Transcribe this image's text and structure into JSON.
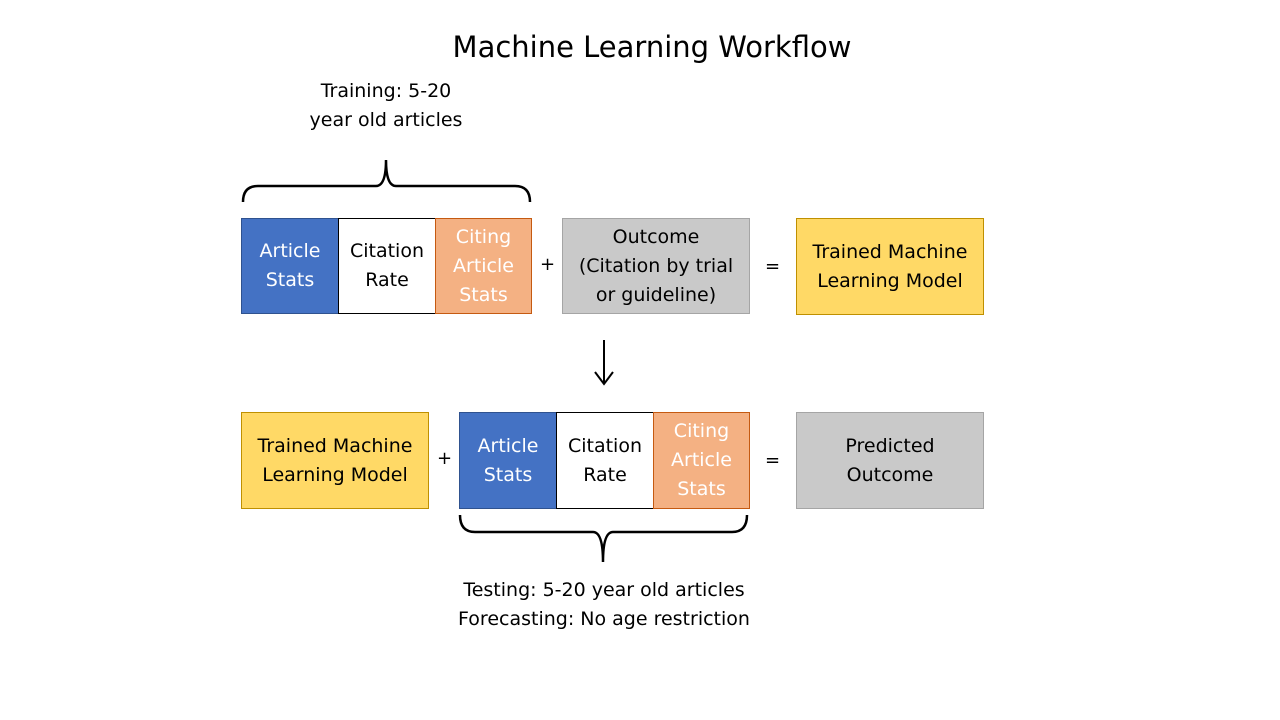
{
  "title": "Machine Learning Workflow",
  "training_note": "Training: 5-20\nyear old articles",
  "testing_note": "Testing: 5-20 year old articles\nForecasting: No age restriction",
  "colors": {
    "article_stats": "#4472C4",
    "citation_rate": "#FFFFFF",
    "citing_article_stats": "#F4B183",
    "outcome": "#C9C9C9",
    "model": "#FFD966"
  },
  "row1": {
    "article_stats": "Article\nStats",
    "citation_rate": "Citation\nRate",
    "citing_article_stats": "Citing\nArticle\nStats",
    "plus": "+",
    "outcome": "Outcome\n(Citation by trial\nor guideline)",
    "equals": "=",
    "model": "Trained Machine\nLearning Model"
  },
  "row2": {
    "model": "Trained Machine\nLearning Model",
    "plus": "+",
    "article_stats": "Article\nStats",
    "citation_rate": "Citation\nRate",
    "citing_article_stats": "Citing\nArticle\nStats",
    "equals": "=",
    "predicted": "Predicted\nOutcome"
  }
}
